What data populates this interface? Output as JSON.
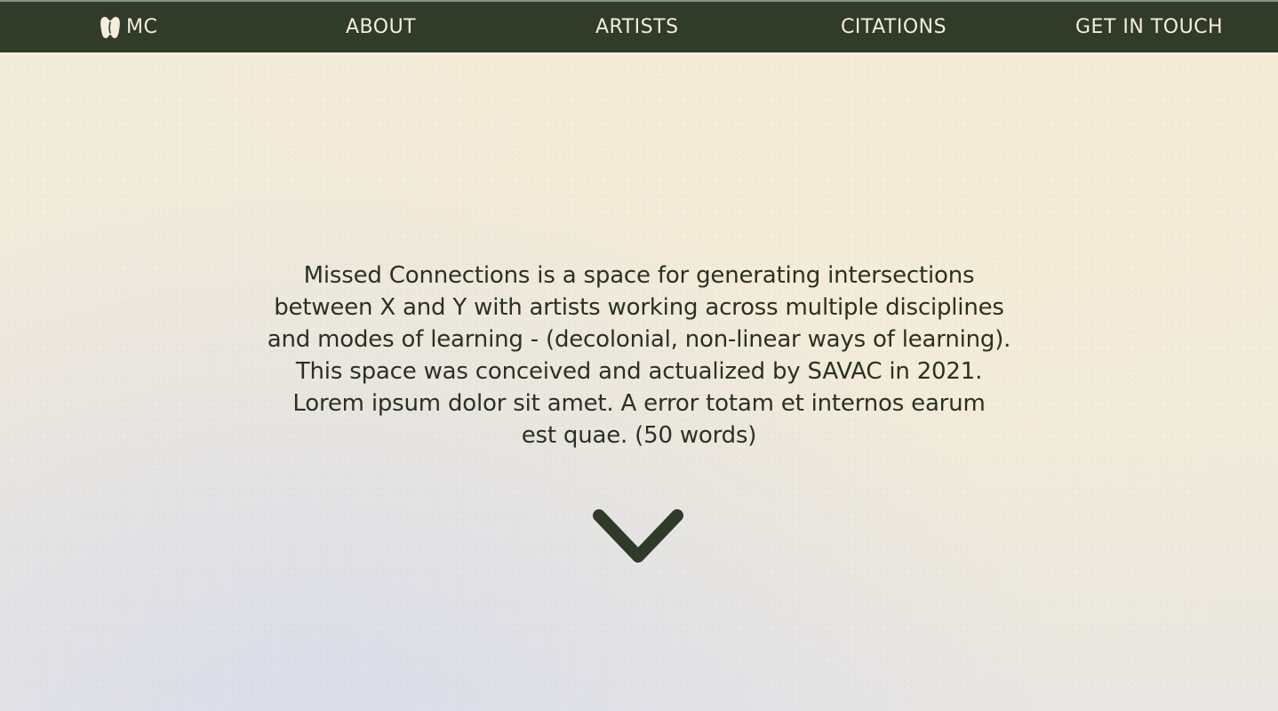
{
  "nav": {
    "home_label": "MC",
    "home_icon": "mc-logo-icon",
    "items": [
      {
        "label": "ABOUT"
      },
      {
        "label": "ARTISTS"
      },
      {
        "label": "CITATIONS"
      },
      {
        "label": "GET IN TOUCH"
      }
    ]
  },
  "hero": {
    "lines": [
      "Missed Connections is a space for generating intersections",
      "between X and Y with artists working across multiple disciplines",
      "and modes of learning - (decolonial, non-linear ways of learning).",
      "This space was conceived and actualized by SAVAC in 2021.",
      "Lorem ipsum dolor sit amet. A error totam et internos earum",
      "est quae. (50 words)"
    ],
    "scroll_icon": "chevron-down-icon"
  },
  "colors": {
    "nav_background": "#313b29",
    "nav_text": "#f4eedd",
    "body_text": "#2a3123",
    "page_background": "#f3ecdb"
  }
}
